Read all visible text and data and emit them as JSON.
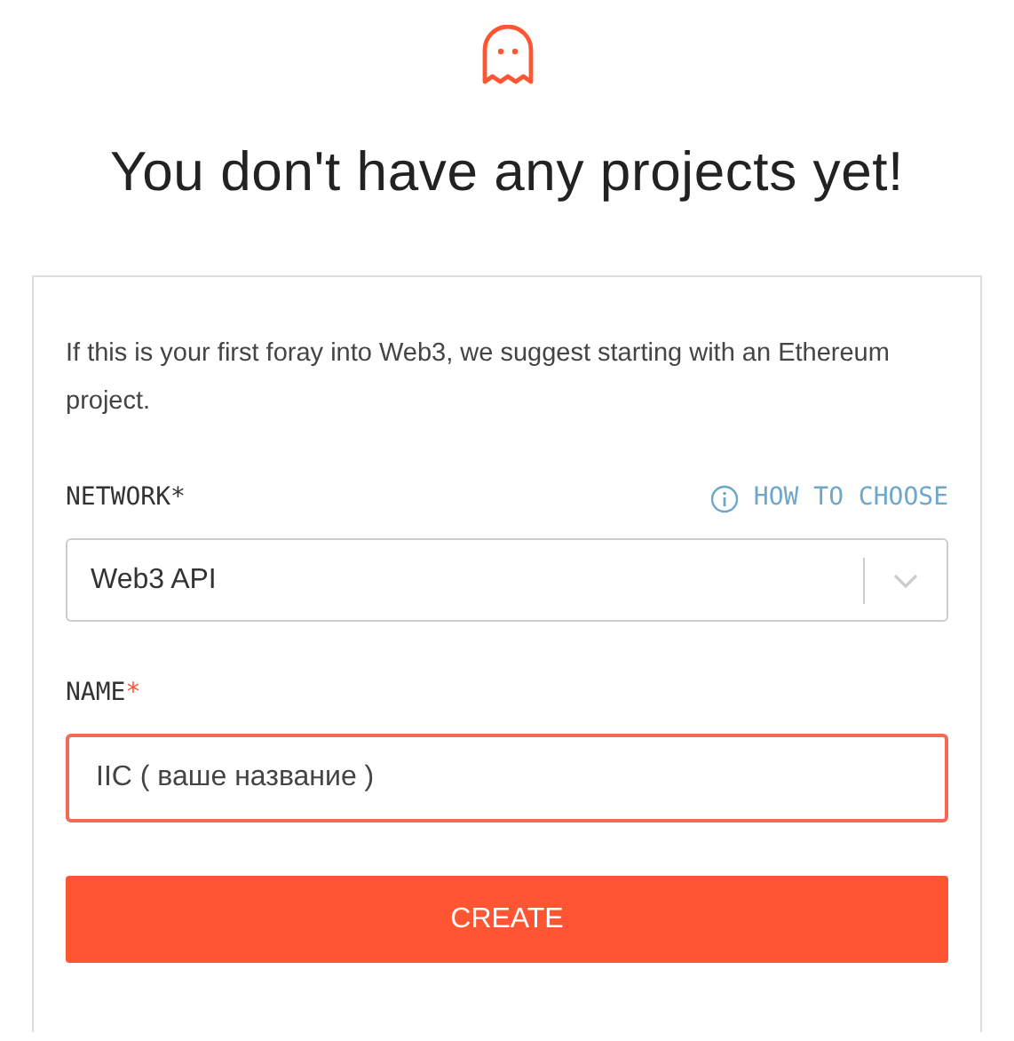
{
  "heading": "You don't have any projects yet!",
  "intro": "If this is your first foray into Web3, we suggest starting with an Ethereum project.",
  "network": {
    "label": "NETWORK",
    "asterisk": "*",
    "asterisk_highlighted": false,
    "help_link": "HOW TO CHOOSE",
    "value": "Web3 API"
  },
  "name": {
    "label": "NAME",
    "asterisk": "*",
    "asterisk_highlighted": true,
    "value": "IIC ( ваше название )",
    "focused": true
  },
  "button": "CREATE"
}
